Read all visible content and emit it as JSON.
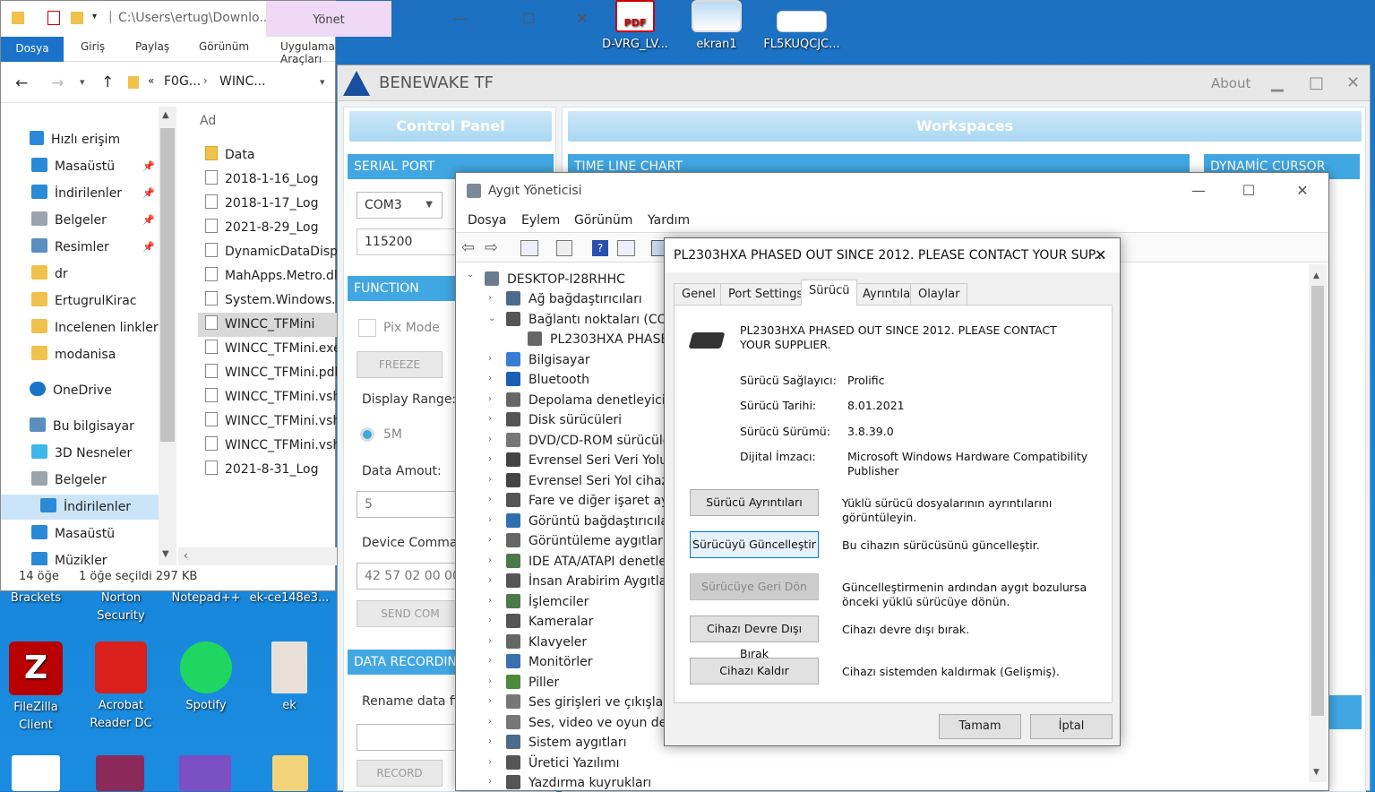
{
  "desktop": {
    "top_icons": [
      {
        "label": "D-VRG_LV..."
      },
      {
        "label": "ekran1"
      },
      {
        "label": "FL5KUQCJC..."
      }
    ],
    "icons_row1": [
      {
        "label": "Brackets"
      },
      {
        "label": "Norton Security"
      },
      {
        "label": "Notepad++"
      },
      {
        "label": "ek-ce148e3..."
      }
    ],
    "icons_row2": [
      {
        "label": "FileZilla Client"
      },
      {
        "label": "Acrobat Reader DC"
      },
      {
        "label": "Spotify"
      },
      {
        "label": "ek"
      }
    ],
    "pdf_label": "PDF"
  },
  "explorer": {
    "path_title": "C:\\Users\\ertug\\Downlo...",
    "manage_tab": "Yönet",
    "ribbon_tabs": [
      "Dosya",
      "Giriş",
      "Paylaş",
      "Görünüm",
      "Uygulama Araçları"
    ],
    "breadcrumb": [
      "«",
      "F0G...",
      "WINC..."
    ],
    "quick_access": "Hızlı erişim",
    "sidebar": [
      {
        "label": "Masaüstü",
        "color": "#2b8ad8"
      },
      {
        "label": "İndirilenler",
        "color": "#2b8ad8"
      },
      {
        "label": "Belgeler",
        "color": "#9aa4ae"
      },
      {
        "label": "Resimler",
        "color": "#5a8fc0"
      },
      {
        "label": "dr",
        "color": "#f0c14b"
      },
      {
        "label": "ErtugrulKirac",
        "color": "#f0c14b"
      },
      {
        "label": "Incelenen linkler",
        "color": "#f0c14b"
      },
      {
        "label": "modanisa",
        "color": "#f0c14b"
      }
    ],
    "onedrive": "OneDrive",
    "this_pc": "Bu bilgisayar",
    "pc_items": [
      {
        "label": "3D Nesneler",
        "color": "#3fb6e8"
      },
      {
        "label": "Belgeler",
        "color": "#9aa4ae"
      },
      {
        "label": "İndirilenler",
        "color": "#2b8ad8"
      },
      {
        "label": "Masaüstü",
        "color": "#2b8ad8"
      },
      {
        "label": "Müzikler",
        "color": "#2b8ad8"
      }
    ],
    "column_header": "Ad",
    "files": [
      "Data",
      "2018-1-16_Log",
      "2018-1-17_Log",
      "2021-8-29_Log",
      "DynamicDataDispl",
      "MahApps.Metro.dll",
      "System.Windows.In",
      "WINCC_TFMini",
      "WINCC_TFMini.exe.",
      "WINCC_TFMini.pdb",
      "WINCC_TFMini.vshc",
      "WINCC_TFMini.vshc",
      "WINCC_TFMini.vshc",
      "2021-8-31_Log"
    ],
    "status_count": "14 öğe",
    "status_selected": "1 öğe seçildi  297 KB"
  },
  "benewake": {
    "title": "BENEWAKE TF",
    "about": "About",
    "control_panel": "Control Panel",
    "workspaces": "Workspaces",
    "serial_port": "SERIAL PORT",
    "com_port": "COM3",
    "baud": "115200",
    "function": "FUNCTION",
    "pix_mode": "Pix Mode",
    "freeze": "FREEZE",
    "display_range": "Display Range:",
    "range_value": "5M",
    "data_amount": "Data Amout:",
    "data_amount_value": "5",
    "device_command": "Device Commar",
    "command_value": "42 57 02 00 00",
    "send_command": "SEND COM",
    "data_recording": "DATA RECORDING",
    "rename_data": "Rename data fil",
    "record": "RECORD",
    "time_line_chart": "TIME LINE CHART",
    "dynamic_cursor": "DYNAMİC CURSOR"
  },
  "device_manager": {
    "title": "Aygıt Yöneticisi",
    "menu": [
      "Dosya",
      "Eylem",
      "Görünüm",
      "Yardım"
    ],
    "root": "DESKTOP-I28RHHC",
    "nodes": [
      {
        "label": "Ağ bağdaştırıcıları",
        "expanded": false
      },
      {
        "label": "Bağlantı noktaları (COM",
        "expanded": true
      },
      {
        "label": "PL2303HXA PHASED",
        "child": true
      },
      {
        "label": "Bilgisayar"
      },
      {
        "label": "Bluetooth"
      },
      {
        "label": "Depolama denetleyicile"
      },
      {
        "label": "Disk sürücüleri"
      },
      {
        "label": "DVD/CD-ROM sürücüle"
      },
      {
        "label": "Evrensel Seri Veri Yolu d"
      },
      {
        "label": "Evrensel Seri Yol cihazla"
      },
      {
        "label": "Fare ve diğer işaret aygı"
      },
      {
        "label": "Görüntü bağdaştırıcıları"
      },
      {
        "label": "Görüntüleme aygıtları"
      },
      {
        "label": "IDE ATA/ATAPI denetleyi"
      },
      {
        "label": "İnsan Arabirim Aygıtları"
      },
      {
        "label": "İşlemciler"
      },
      {
        "label": "Kameralar"
      },
      {
        "label": "Klavyeler"
      },
      {
        "label": "Monitörler"
      },
      {
        "label": "Piller"
      },
      {
        "label": "Ses girişleri ve çıkışları"
      },
      {
        "label": "Ses, video ve oyun dene"
      },
      {
        "label": "Sistem aygıtları"
      },
      {
        "label": "Üretici Yazılımı"
      },
      {
        "label": "Yazdırma kuyrukları"
      }
    ]
  },
  "properties": {
    "title": "PL2303HXA PHASED OUT SINCE 2012. PLEASE CONTACT YOUR SUP...",
    "tabs": [
      "Genel",
      "Port Settings",
      "Sürücü",
      "Ayrıntılar",
      "Olaylar"
    ],
    "active_tab": "Sürücü",
    "device_name_line1": "PL2303HXA PHASED OUT SINCE 2012. PLEASE CONTACT",
    "device_name_line2": "YOUR SUPPLIER.",
    "provider_label": "Sürücü Sağlayıcı:",
    "provider_value": "Prolific",
    "date_label": "Sürücü Tarihi:",
    "date_value": "8.01.2021",
    "version_label": "Sürücü Sürümü:",
    "version_value": "3.8.39.0",
    "signer_label": "Dijital İmzacı:",
    "signer_value_line1": "Microsoft Windows Hardware Compatibility",
    "signer_value_line2": "Publisher",
    "actions": [
      {
        "button": "Sürücü Ayrıntıları",
        "desc1": "Yüklü sürücü dosyalarının ayrıntılarını",
        "desc2": "görüntüleyin."
      },
      {
        "button": "Sürücüyü Güncelleştir",
        "desc1": "Bu cihazın sürücüsünü güncelleştir.",
        "desc2": ""
      },
      {
        "button": "Sürücüye Geri Dön",
        "desc1": "Güncelleştirmenin ardından aygıt bozulursa",
        "desc2": "önceki yüklü sürücüye dönün."
      },
      {
        "button": "Cihazı Devre Dışı Bırak",
        "desc1": "Cihazı devre dışı bırak.",
        "desc2": ""
      },
      {
        "button": "Cihazı Kaldır",
        "desc1": "Cihazı sistemden kaldırmak (Gelişmiş).",
        "desc2": ""
      }
    ],
    "ok": "Tamam",
    "cancel": "İptal"
  }
}
